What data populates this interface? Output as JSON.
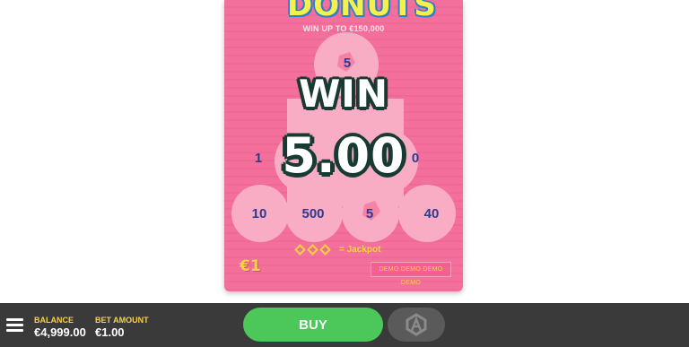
{
  "game": {
    "logo_text": "DONUTS",
    "win_up_to": "WIN UP TO €150,000",
    "win_word": "WIN",
    "win_amount": "5.00",
    "grid": {
      "row1": [
        "5"
      ],
      "row2_visible_left": "1",
      "row2_visible_right": "0",
      "row3": [
        "10",
        "500",
        "5",
        "40"
      ]
    },
    "jackpot_label": "= Jackpot",
    "price": "€1",
    "demo_text": "DEMO DEMO DEMO DEMO"
  },
  "bottom_bar": {
    "balance_label": "BALANCE",
    "balance_value": "€4,999.00",
    "bet_label": "BET AMOUNT",
    "bet_value": "€1.00",
    "buy_label": "BUY"
  },
  "colors": {
    "card_pink": "#f3709c",
    "circle_pink": "#fbb8cd",
    "accent_yellow": "#f6d24a",
    "buy_green": "#4cc85a",
    "bar_bg": "#3a3a3a"
  },
  "icons": [
    "menu-icon",
    "autoplay-icon",
    "jackpot-diamond-icon",
    "donut-icon"
  ]
}
